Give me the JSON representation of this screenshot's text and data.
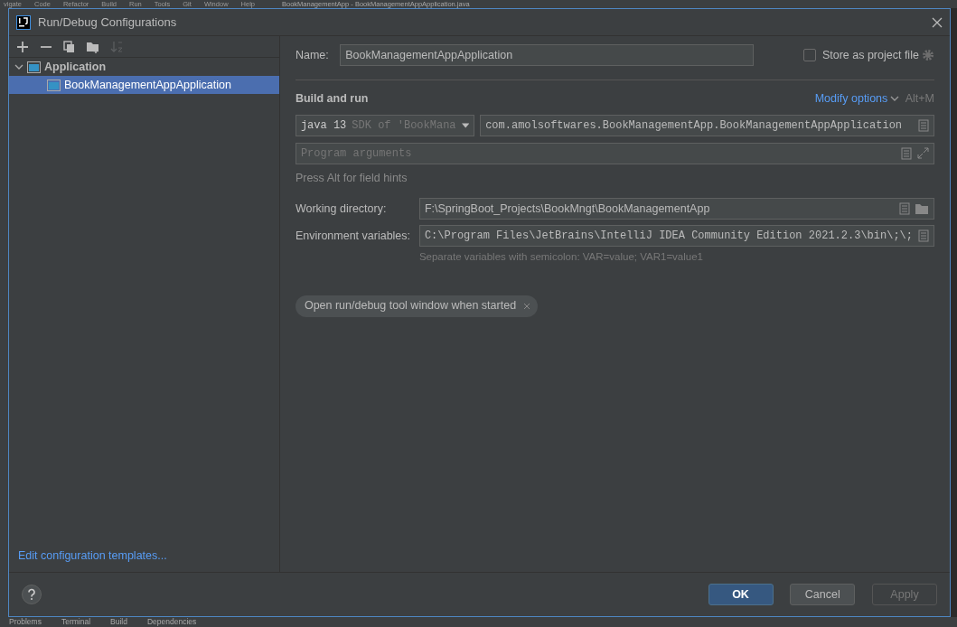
{
  "ide_menu": [
    "vigate",
    "Code",
    "Refactor",
    "Build",
    "Run",
    "Tools",
    "Git",
    "Window",
    "Help"
  ],
  "ide_title": "BookManagementApp - BookManagementAppApplication.java",
  "dialog": {
    "title": "Run/Debug Configurations"
  },
  "toolbar": [
    {
      "kind": "add",
      "disabled": false
    },
    {
      "kind": "remove",
      "disabled": false
    },
    {
      "kind": "copy",
      "disabled": false
    },
    {
      "kind": "folder",
      "disabled": false
    },
    {
      "kind": "sort",
      "disabled": true
    }
  ],
  "tree": [
    {
      "label": "Application",
      "expanded": true,
      "selected": false,
      "children": [
        {
          "label": "BookManagementAppApplication",
          "selected": true
        }
      ]
    }
  ],
  "templates_link": "Edit configuration templates...",
  "name": {
    "label": "Name:",
    "value": "BookManagementAppApplication"
  },
  "store_as_project_file": {
    "label": "Store as project file",
    "checked": false
  },
  "section_title": "Build and run",
  "modify_options": {
    "label": "Modify options",
    "shortcut": "Alt+M"
  },
  "jre": {
    "version": "java 13",
    "detail": "SDK of 'BookMana"
  },
  "main_class": "com.amolsoftwares.BookManagementApp.BookManagementAppApplication",
  "program_arguments": {
    "placeholder": "Program arguments"
  },
  "hint": "Press Alt for field hints",
  "working_directory": {
    "label": "Working directory:",
    "value": "F:\\SpringBoot_Projects\\BookMngt\\BookManagementApp"
  },
  "environment_variables": {
    "label": "Environment variables:",
    "value": "C:\\Program Files\\JetBrains\\IntelliJ IDEA Community Edition 2021.2.3\\bin\\;\\;",
    "note": "Separate variables with semicolon: VAR=value; VAR1=value1"
  },
  "option_tags": [
    "Open run/debug tool window when started"
  ],
  "buttons": [
    {
      "label": "OK",
      "kind": "primary",
      "disabled": false
    },
    {
      "label": "Cancel",
      "kind": "secondary",
      "disabled": false
    },
    {
      "label": "Apply",
      "kind": "secondary",
      "disabled": true
    }
  ],
  "bottom_tabs": [
    "Problems",
    "Terminal",
    "Build",
    "Dependencies"
  ]
}
